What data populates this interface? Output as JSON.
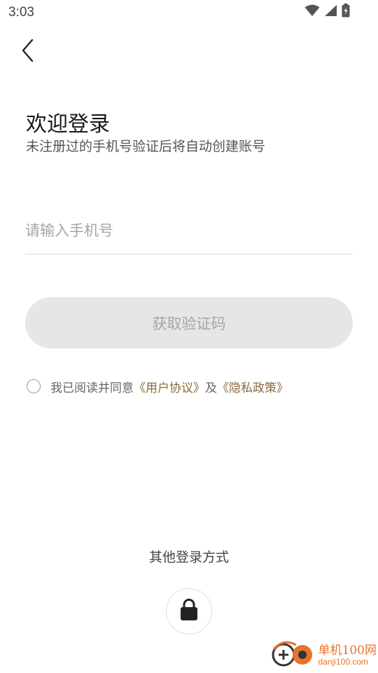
{
  "status_bar": {
    "time": "3:03",
    "icons": [
      "wifi-icon",
      "cellular-signal-icon",
      "battery-charging-icon"
    ]
  },
  "header": {
    "back_icon": "back-arrow-icon"
  },
  "welcome": {
    "title": "欢迎登录",
    "subtitle": "未注册过的手机号验证后将自动创建账号"
  },
  "phone": {
    "placeholder": "请输入手机号",
    "value": ""
  },
  "get_code_button": {
    "label": "获取验证码",
    "enabled": false
  },
  "agreement": {
    "checked": false,
    "prefix": "我已阅读并同意",
    "user_agreement": "《用户协议》",
    "conjunction": "及",
    "privacy_policy": "《隐私政策》"
  },
  "other_login": {
    "label": "其他登录方式",
    "options": [
      "lock-icon"
    ]
  },
  "watermark": {
    "title": "单机100网",
    "url": "danji100.com"
  },
  "colors": {
    "link": "#8a6a3e",
    "button_disabled_bg": "#e6e6e6",
    "button_disabled_text": "#a6a6a6",
    "watermark": "#e8732a"
  }
}
